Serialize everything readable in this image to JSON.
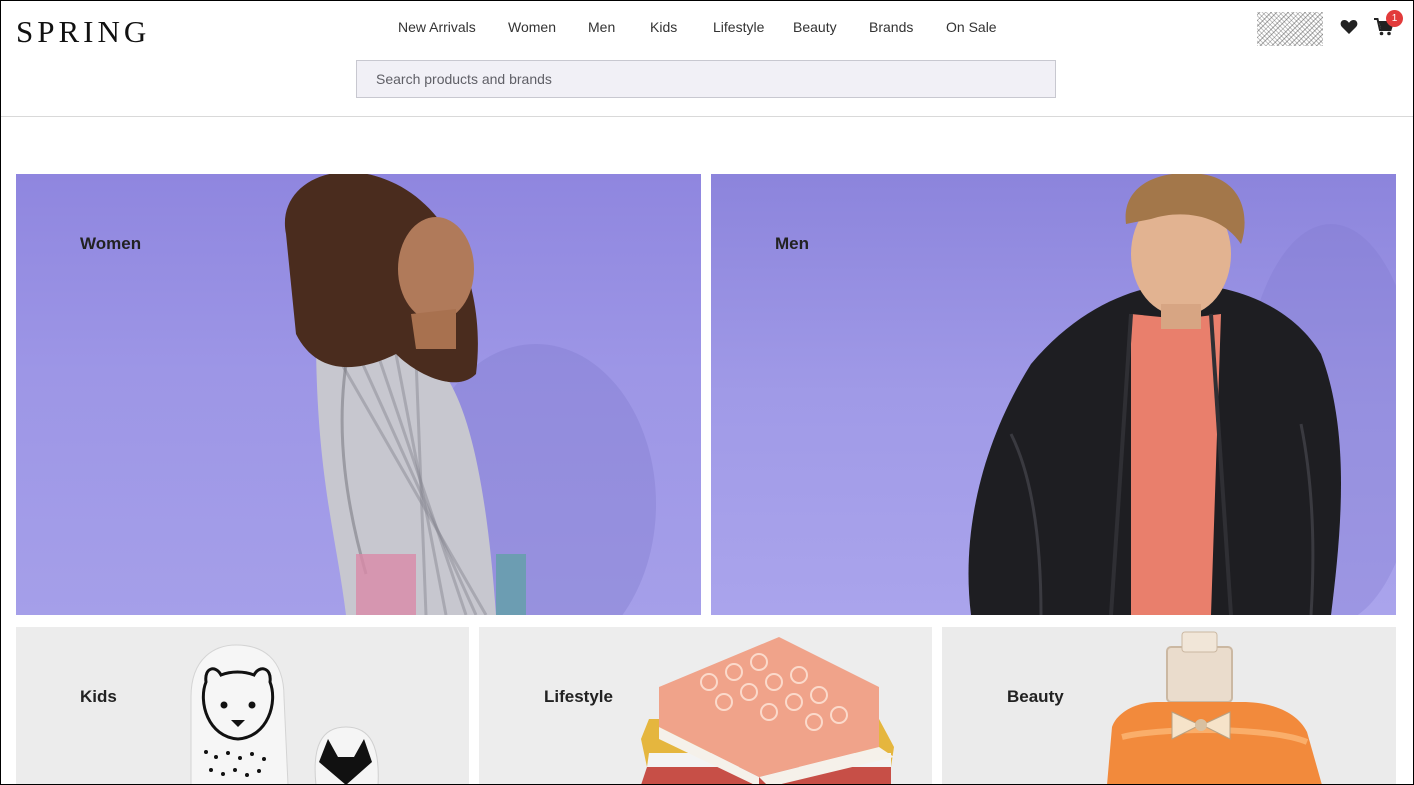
{
  "header": {
    "logo": "SPRING",
    "nav": [
      "New Arrivals",
      "Women",
      "Men",
      "Kids",
      "Lifestyle",
      "Beauty",
      "Brands",
      "On Sale"
    ],
    "search_placeholder": "Search products and brands",
    "cart_count": "1",
    "icons": [
      "heart-icon",
      "cart-icon"
    ]
  },
  "tiles": {
    "women": "Women",
    "men": "Men",
    "kids": "Kids",
    "lifestyle": "Lifestyle",
    "beauty": "Beauty"
  },
  "colors": {
    "accent_badge": "#e23b3b",
    "tile_purple": "#9d96e6",
    "search_bg": "#f1f0f6"
  }
}
